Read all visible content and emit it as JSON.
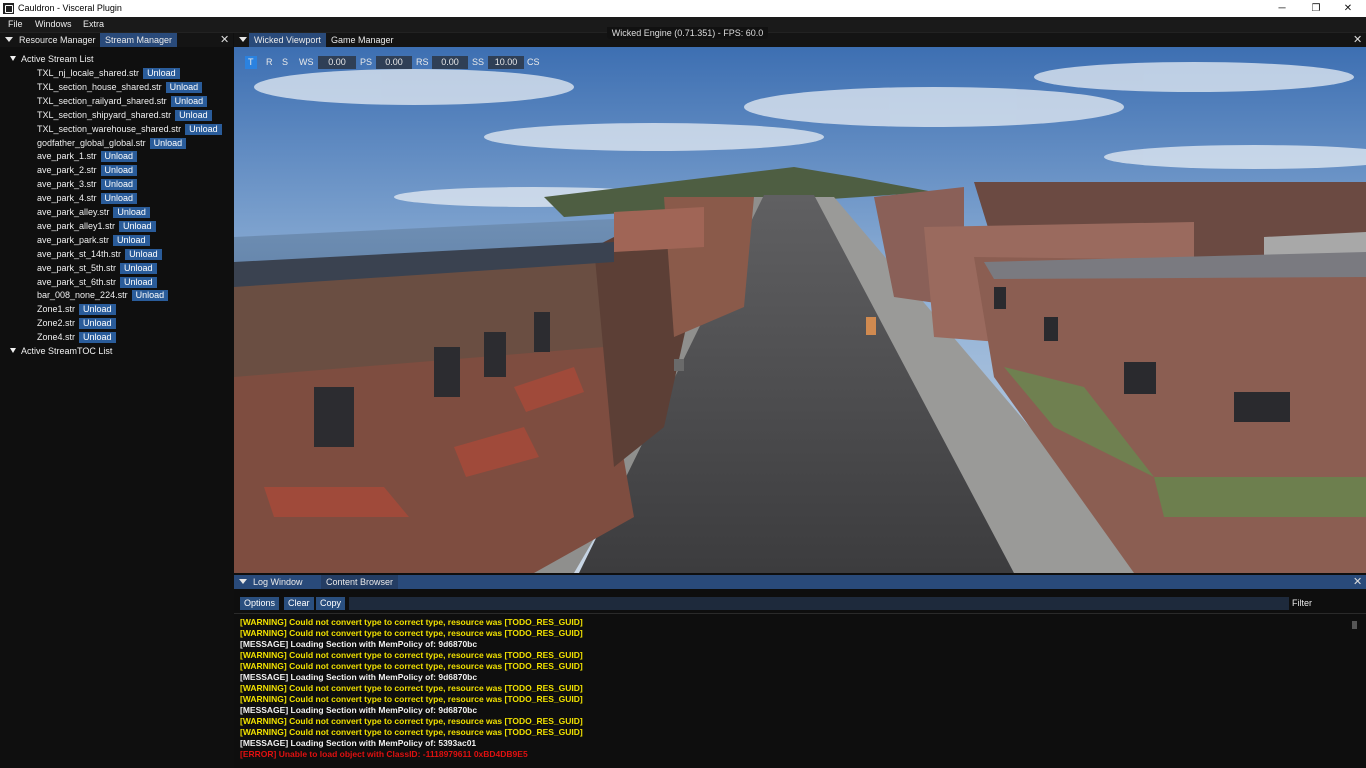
{
  "window": {
    "title": "Cauldron - Visceral Plugin",
    "controls": [
      "─",
      "❐",
      "✕"
    ]
  },
  "menubar": [
    "File",
    "Windows",
    "Extra"
  ],
  "left_panel": {
    "tabs": [
      "Resource Manager",
      "Stream Manager"
    ],
    "active_tab": 1,
    "close": "✕",
    "section1": "Active Stream List",
    "section2": "Active StreamTOC List",
    "unload_label": "Unload",
    "streams": [
      "TXL_nj_locale_shared.str",
      "TXL_section_house_shared.str",
      "TXL_section_railyard_shared.str",
      "TXL_section_shipyard_shared.str",
      "TXL_section_warehouse_shared.str",
      "godfather_global_global.str",
      "ave_park_1.str",
      "ave_park_2.str",
      "ave_park_3.str",
      "ave_park_4.str",
      "ave_park_alley.str",
      "ave_park_alley1.str",
      "ave_park_park.str",
      "ave_park_st_14th.str",
      "ave_park_st_5th.str",
      "ave_park_st_6th.str",
      "bar_008_none_224.str",
      "Zone1.str",
      "Zone2.str",
      "Zone4.str"
    ]
  },
  "viewport": {
    "tabs": [
      "Wicked Viewport",
      "Game Manager"
    ],
    "close": "✕",
    "fps_overlay": "Wicked Engine (0.71.351) - FPS: 60.0",
    "toolbar": {
      "t": "T",
      "r": "R",
      "s": "S",
      "ws_label": "WS",
      "ws_value": "0.00",
      "ps_label": "PS",
      "ps_value": "0.00",
      "rs_label": "RS",
      "rs_value": "0.00",
      "ss_label": "SS",
      "ss_value": "10.00",
      "cs_label": "CS"
    },
    "colors": {
      "sky_top": "#3f74b8",
      "road": "#4a4a4c",
      "brick": "#7a4a3e",
      "sidewalk": "#9a9a98"
    }
  },
  "log": {
    "tabs": [
      "Log Window",
      "Content Browser"
    ],
    "close": "✕",
    "buttons": {
      "options": "Options",
      "clear": "Clear",
      "copy": "Copy"
    },
    "filter_label": "Filter",
    "lines": [
      {
        "type": "warning",
        "text": "[WARNING] Could not convert type to correct type, resource was [TODO_RES_GUID]"
      },
      {
        "type": "warning",
        "text": "[WARNING] Could not convert type to correct type, resource was [TODO_RES_GUID]"
      },
      {
        "type": "message",
        "text": "[MESSAGE] Loading Section with MemPolicy of: 9d6870bc"
      },
      {
        "type": "warning",
        "text": "[WARNING] Could not convert type to correct type, resource was [TODO_RES_GUID]"
      },
      {
        "type": "warning",
        "text": "[WARNING] Could not convert type to correct type, resource was [TODO_RES_GUID]"
      },
      {
        "type": "message",
        "text": "[MESSAGE] Loading Section with MemPolicy of: 9d6870bc"
      },
      {
        "type": "warning",
        "text": "[WARNING] Could not convert type to correct type, resource was [TODO_RES_GUID]"
      },
      {
        "type": "warning",
        "text": "[WARNING] Could not convert type to correct type, resource was [TODO_RES_GUID]"
      },
      {
        "type": "message",
        "text": "[MESSAGE] Loading Section with MemPolicy of: 9d6870bc"
      },
      {
        "type": "warning",
        "text": "[WARNING] Could not convert type to correct type, resource was [TODO_RES_GUID]"
      },
      {
        "type": "warning",
        "text": "[WARNING] Could not convert type to correct type, resource was [TODO_RES_GUID]"
      },
      {
        "type": "message",
        "text": "[MESSAGE] Loading Section with MemPolicy of: 5393ac01"
      },
      {
        "type": "error",
        "text": "[ERROR] Unable to load object with ClassID: -1118979611 0xBD4DB9E5"
      }
    ],
    "colors": {
      "warning": "#f0e000",
      "message": "#f2f2f2",
      "error": "#e01010"
    }
  }
}
